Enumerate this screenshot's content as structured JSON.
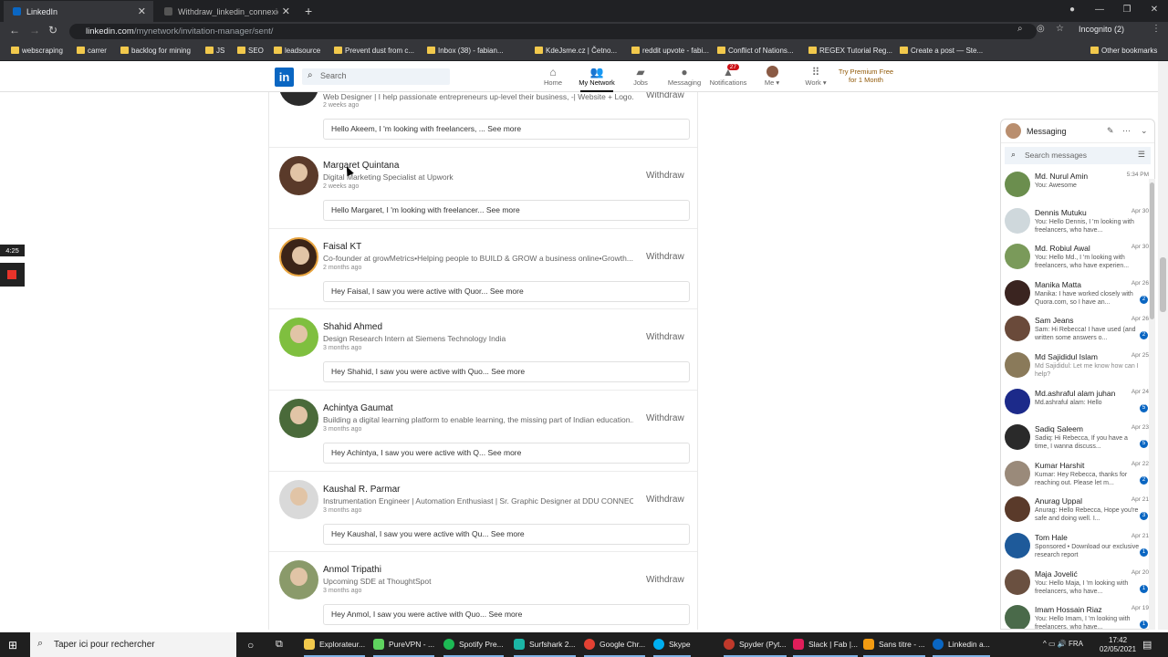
{
  "browser": {
    "tabs": [
      {
        "title": "LinkedIn",
        "active": true
      },
      {
        "title": "Withdraw_linkedin_connexion_re",
        "active": false
      }
    ],
    "url_host": "linkedin.com",
    "url_path": "/mynetwork/invitation-manager/sent/",
    "profile": "Incognito (2)",
    "bookmarks": [
      "webscraping",
      "carrer",
      "backlog for mining",
      "JS",
      "SEO",
      "leadsource",
      "Prevent dust from c...",
      "Inbox (38) - fabian...",
      "KdeJsme.cz | Četno...",
      "reddit upvote - fabi...",
      "Conflict of Nations...",
      "REGEX Tutorial Reg...",
      "Create a post — Ste..."
    ],
    "other_bookmarks": "Other bookmarks"
  },
  "linkedin": {
    "logo": "in",
    "search_placeholder": "Search",
    "nav": [
      {
        "label": "Home",
        "icon": "home-icon",
        "badge": ""
      },
      {
        "label": "My Network",
        "icon": "network-icon",
        "badge": ""
      },
      {
        "label": "Jobs",
        "icon": "briefcase-icon",
        "badge": ""
      },
      {
        "label": "Messaging",
        "icon": "chat-icon",
        "badge": ""
      },
      {
        "label": "Notifications",
        "icon": "bell-icon",
        "badge": "27"
      },
      {
        "label": "Me",
        "icon": "avatar-icon",
        "badge": ""
      },
      {
        "label": "Work",
        "icon": "grid-icon",
        "badge": ""
      }
    ],
    "premium": "Try Premium Free for 1 Month"
  },
  "invitations": [
    {
      "name": "",
      "headline": "Web Designer | I help passionate entrepreneurs up-level their business, -| Website + Logo...",
      "time": "2 weeks ago",
      "message": "Hello Akeem, I 'm looking with freelancers, ...",
      "see_more": "See more",
      "withdraw": "Withdraw"
    },
    {
      "name": "Margaret Quintana",
      "headline": "Digital Marketing Specialist at Upwork",
      "time": "2 weeks ago",
      "message": "Hello Margaret, I 'm looking with freelancer...",
      "see_more": "See more",
      "withdraw": "Withdraw"
    },
    {
      "name": "Faisal KT",
      "headline": "Co-founder at growMetrics•Helping people to BUILD & GROW a business online•Growth...",
      "time": "2 months ago",
      "message": "Hey Faisal, I saw you were active with Quor...",
      "see_more": "See more",
      "withdraw": "Withdraw"
    },
    {
      "name": "Shahid Ahmed",
      "headline": "Design Research Intern at Siemens Technology India",
      "time": "3 months ago",
      "message": "Hey Shahid, I saw you were active with Quo...",
      "see_more": "See more",
      "withdraw": "Withdraw"
    },
    {
      "name": "Achintya Gaumat",
      "headline": "Building a digital learning platform to enable learning, the missing part of Indian education...",
      "time": "3 months ago",
      "message": "Hey Achintya, I saw you were active with Q...",
      "see_more": "See more",
      "withdraw": "Withdraw"
    },
    {
      "name": "Kaushal R. Parmar",
      "headline": "Instrumentation Engineer | Automation Enthusiast | Sr. Graphic Designer at DDU CONNECT",
      "time": "3 months ago",
      "message": "Hey Kaushal, I saw you were active with Qu...",
      "see_more": "See more",
      "withdraw": "Withdraw"
    },
    {
      "name": "Anmol Tripathi",
      "headline": "Upcoming SDE at ThoughtSpot",
      "time": "3 months ago",
      "message": "Hey Anmol, I saw you were active with Quo...",
      "see_more": "See more",
      "withdraw": "Withdraw"
    }
  ],
  "recorder": {
    "time": "4:25"
  },
  "messaging": {
    "title": "Messaging",
    "search_placeholder": "Search messages",
    "conversations": [
      {
        "name": "Md. Nurul Amin",
        "preview": "You: Awesome",
        "date": "5:34 PM",
        "unread": ""
      },
      {
        "name": "Dennis Mutuku",
        "preview": "You: Hello Dennis, I 'm looking with freelancers, who have...",
        "date": "Apr 30",
        "unread": ""
      },
      {
        "name": "Md. Robiul Awal",
        "preview": "You: Hello Md., I 'm looking with freelancers, who have experien...",
        "date": "Apr 30",
        "unread": ""
      },
      {
        "name": "Manika Matta",
        "preview": "Manika: I have worked closely with Quora.com, so I have an...",
        "date": "Apr 26",
        "unread": "2"
      },
      {
        "name": "Sam Jeans",
        "preview": "Sam: Hi Rebecca! I have used (and written some answers o...",
        "date": "Apr 26",
        "unread": "2"
      },
      {
        "name": "Md Sajididul Islam",
        "preview": "Md Sajididul: Let me know how can I help?",
        "date": "Apr 25",
        "unread": ""
      },
      {
        "name": "Md.ashraful alam juhan",
        "preview": "Md.ashraful alam: Hello",
        "date": "Apr 24",
        "unread": "5"
      },
      {
        "name": "Sadiq Saleem",
        "preview": "Sadiq: Hi Rebecca, If you have a time, I wanna discuss...",
        "date": "Apr 23",
        "unread": "5"
      },
      {
        "name": "Kumar Harshit",
        "preview": "Kumar: Hey Rebecca, thanks for reaching out. Please let m...",
        "date": "Apr 22",
        "unread": "2"
      },
      {
        "name": "Anurag Uppal",
        "preview": "Anurag: Hello Rebecca, Hope you're safe and doing well. I...",
        "date": "Apr 21",
        "unread": "3"
      },
      {
        "name": "Tom Hale",
        "preview": "Sponsored • Download our exclusive research report",
        "date": "Apr 21",
        "unread": "1"
      },
      {
        "name": "Maja Jovelić",
        "preview": "You: Hello Maja, I 'm looking with freelancers, who have...",
        "date": "Apr 20",
        "unread": "1"
      },
      {
        "name": "Imam Hossain Riaz",
        "preview": "You: Hello Imam, I 'm looking with freelancers, who have...",
        "date": "Apr 19",
        "unread": "1"
      }
    ]
  },
  "taskbar": {
    "search_placeholder": "Taper ici pour rechercher",
    "items": [
      "Explorateur...",
      "PureVPN - ...",
      "Spotify Pre...",
      "Surfshark 2...",
      "Google Chr...",
      "Skype",
      "Spyder (Pyt...",
      "Slack | Fab |...",
      "Sans titre - ...",
      "Linkedin a..."
    ],
    "lang": "FRA",
    "time": "17:42",
    "date": "02/05/2021"
  }
}
